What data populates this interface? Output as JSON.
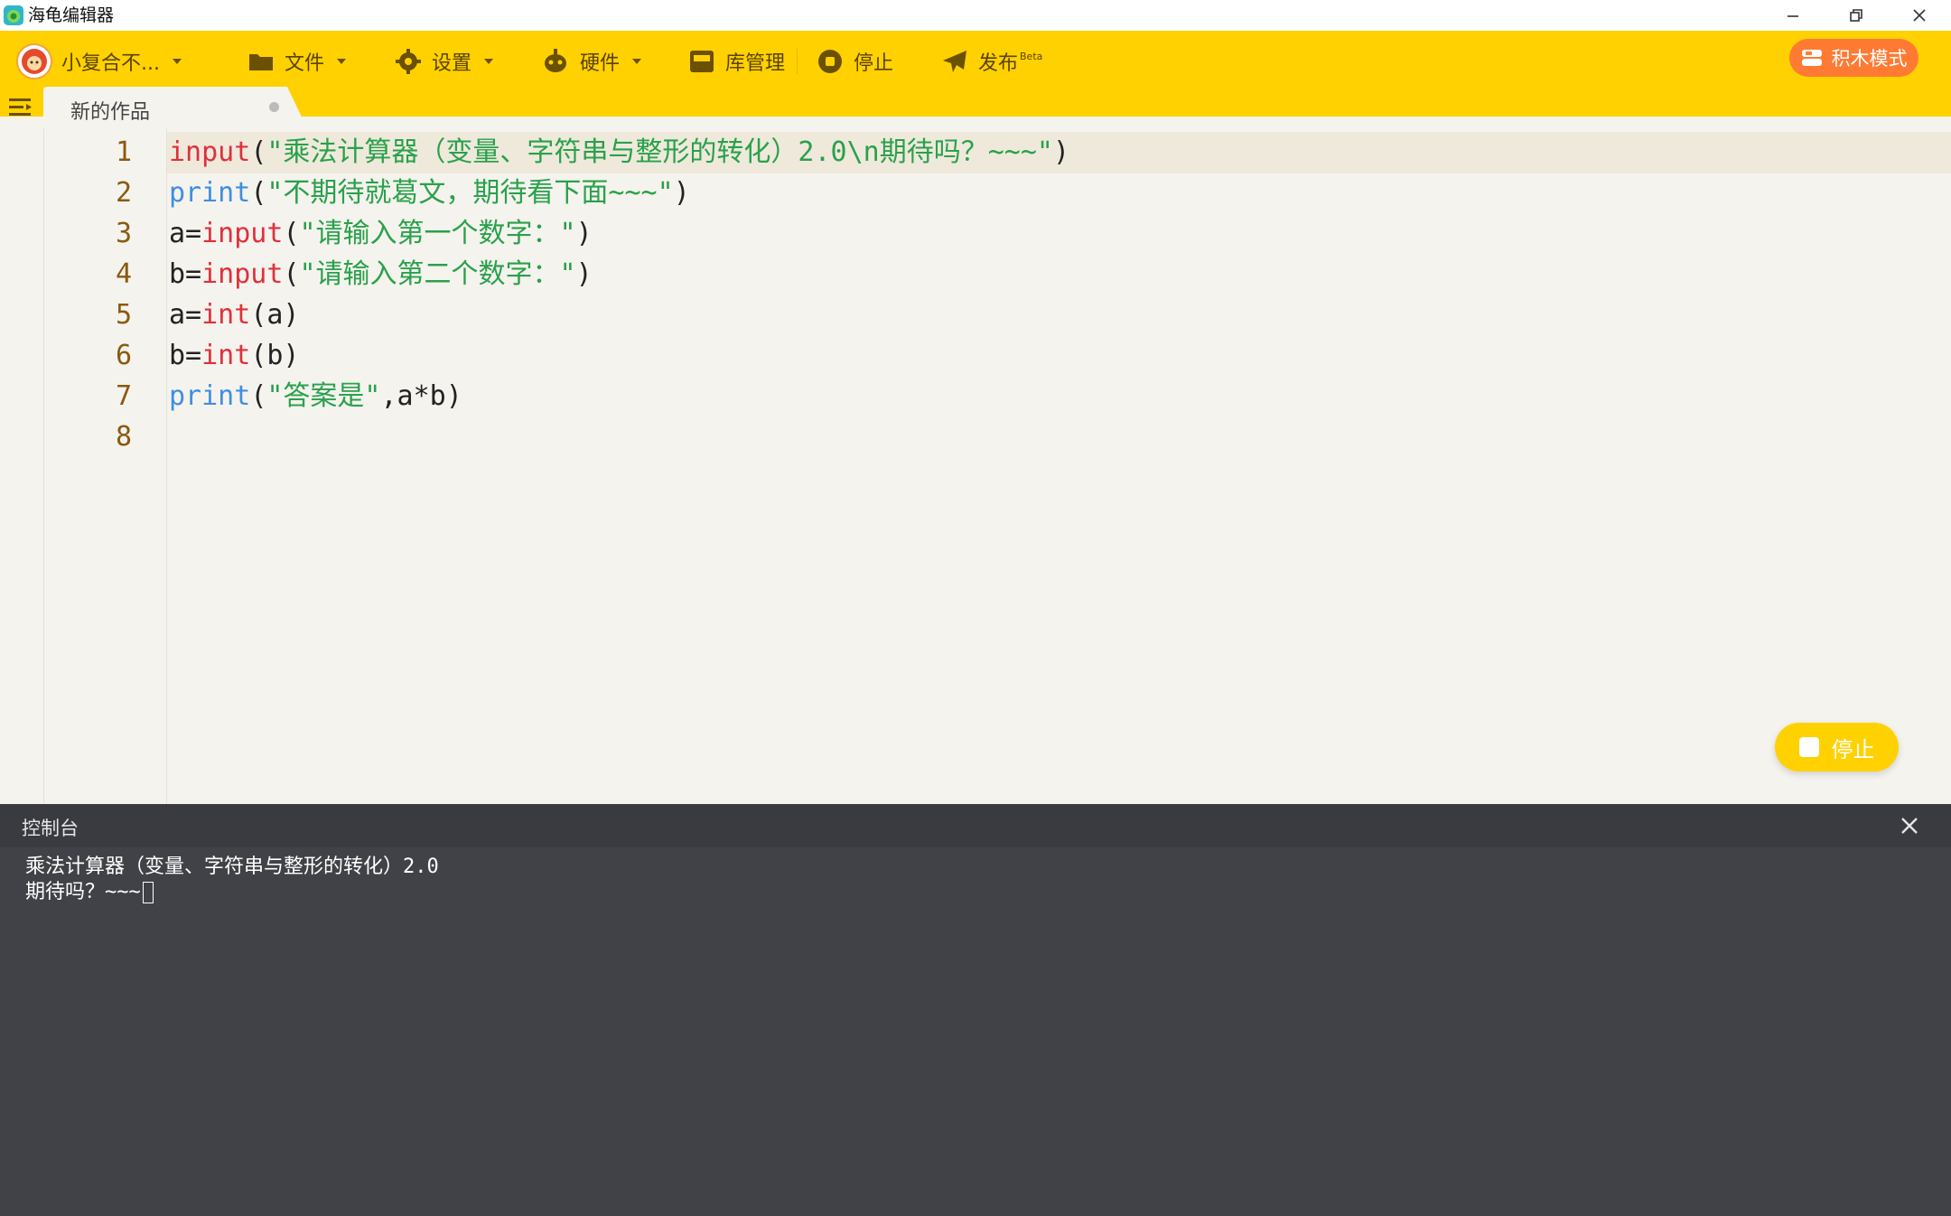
{
  "window": {
    "title": "海龟编辑器"
  },
  "toolbar": {
    "user": "小复合不...",
    "file": "文件",
    "settings": "设置",
    "hardware": "硬件",
    "library": "库管理",
    "stop": "停止",
    "publish": "发布",
    "publish_badge": "Beta",
    "blocks_mode": "积木模式"
  },
  "tabs": [
    {
      "label": "新的作品"
    }
  ],
  "editor": {
    "line_numbers": [
      "1",
      "2",
      "3",
      "4",
      "5",
      "6",
      "7",
      "8"
    ],
    "lines": [
      [
        {
          "t": "input",
          "c": "kw-red"
        },
        {
          "t": "(",
          "c": ""
        },
        {
          "t": "\"乘法计算器（变量、字符串与整形的转化）2.0\\n期待吗？~~~\"",
          "c": "str"
        },
        {
          "t": ")",
          "c": ""
        }
      ],
      [
        {
          "t": "print",
          "c": "kw-blue"
        },
        {
          "t": "(",
          "c": ""
        },
        {
          "t": "\"不期待就葛文，期待看下面~~~\"",
          "c": "str"
        },
        {
          "t": ")",
          "c": ""
        }
      ],
      [
        {
          "t": "a=",
          "c": ""
        },
        {
          "t": "input",
          "c": "kw-red"
        },
        {
          "t": "(",
          "c": ""
        },
        {
          "t": "\"请输入第一个数字：\"",
          "c": "str"
        },
        {
          "t": ")",
          "c": ""
        }
      ],
      [
        {
          "t": "b=",
          "c": ""
        },
        {
          "t": "input",
          "c": "kw-red"
        },
        {
          "t": "(",
          "c": ""
        },
        {
          "t": "\"请输入第二个数字：\"",
          "c": "str"
        },
        {
          "t": ")",
          "c": ""
        }
      ],
      [
        {
          "t": "a=",
          "c": ""
        },
        {
          "t": "int",
          "c": "kw-red"
        },
        {
          "t": "(a)",
          "c": ""
        }
      ],
      [
        {
          "t": "b=",
          "c": ""
        },
        {
          "t": "int",
          "c": "kw-red"
        },
        {
          "t": "(b)",
          "c": ""
        }
      ],
      [
        {
          "t": "print",
          "c": "kw-blue"
        },
        {
          "t": "(",
          "c": ""
        },
        {
          "t": "\"答案是\"",
          "c": "str"
        },
        {
          "t": ",a*b)",
          "c": ""
        }
      ],
      []
    ]
  },
  "float_stop": "停止",
  "console": {
    "title": "控制台",
    "output": [
      "乘法计算器（变量、字符串与整形的转化）2.0",
      "期待吗？~~~"
    ]
  },
  "colors": {
    "toolbar": "#ffd100",
    "accent": "#ff7a33",
    "console_bg": "#404247"
  }
}
